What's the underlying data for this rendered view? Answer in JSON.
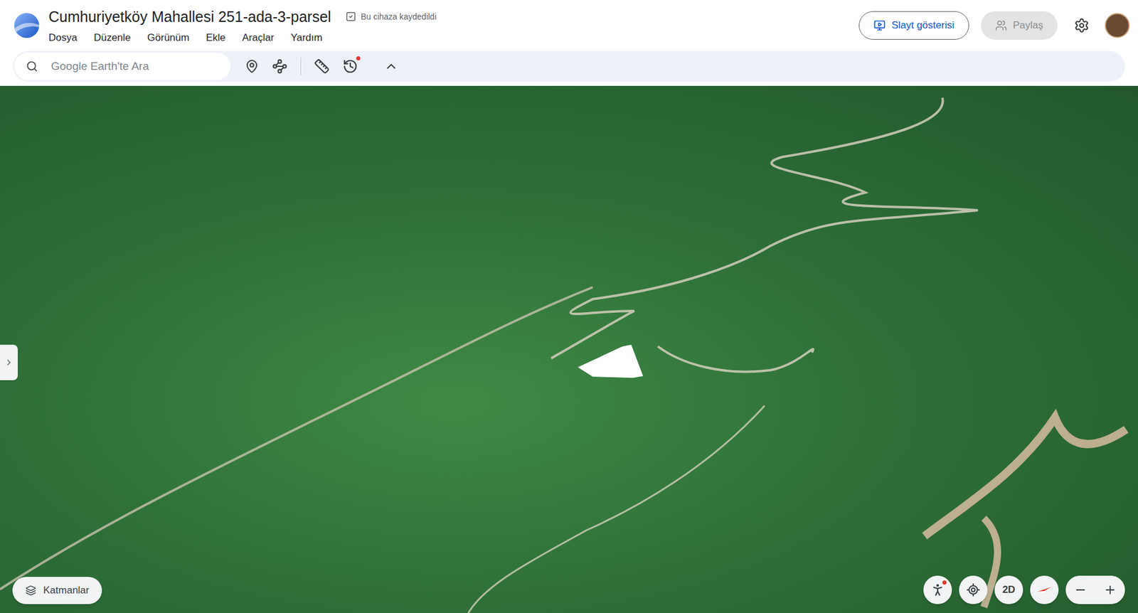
{
  "window": {
    "title": "Cumhuriyetköy Mahallesi 251-ada-3-parsel",
    "save_status": "Bu cihaza kaydedildi"
  },
  "menu": [
    {
      "label": "Dosya"
    },
    {
      "label": "Düzenle"
    },
    {
      "label": "Görünüm"
    },
    {
      "label": "Ekle"
    },
    {
      "label": "Araçlar"
    },
    {
      "label": "Yardım"
    }
  ],
  "header_buttons": [
    {
      "label": "Slayt gösterisi",
      "disabled": false
    },
    {
      "label": "Paylaş",
      "disabled": true
    }
  ],
  "search": {
    "placeholder": "Google Earth'te Ara"
  },
  "toolbar": {
    "history_badge": true
  },
  "map": {
    "layers_button": "Katmanlar",
    "view_mode_button": "2D",
    "street_view_badge": true
  }
}
